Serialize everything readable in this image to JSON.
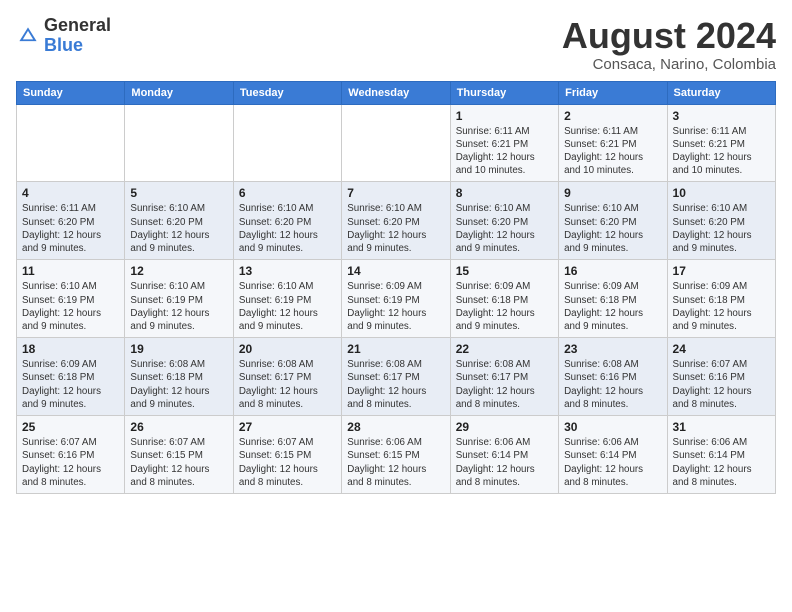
{
  "header": {
    "logo_line1": "General",
    "logo_line2": "Blue",
    "month_year": "August 2024",
    "location": "Consaca, Narino, Colombia"
  },
  "weekdays": [
    "Sunday",
    "Monday",
    "Tuesday",
    "Wednesday",
    "Thursday",
    "Friday",
    "Saturday"
  ],
  "weeks": [
    [
      {
        "day": "",
        "info": ""
      },
      {
        "day": "",
        "info": ""
      },
      {
        "day": "",
        "info": ""
      },
      {
        "day": "",
        "info": ""
      },
      {
        "day": "1",
        "info": "Sunrise: 6:11 AM\nSunset: 6:21 PM\nDaylight: 12 hours and 10 minutes."
      },
      {
        "day": "2",
        "info": "Sunrise: 6:11 AM\nSunset: 6:21 PM\nDaylight: 12 hours and 10 minutes."
      },
      {
        "day": "3",
        "info": "Sunrise: 6:11 AM\nSunset: 6:21 PM\nDaylight: 12 hours and 10 minutes."
      }
    ],
    [
      {
        "day": "4",
        "info": "Sunrise: 6:11 AM\nSunset: 6:20 PM\nDaylight: 12 hours and 9 minutes."
      },
      {
        "day": "5",
        "info": "Sunrise: 6:10 AM\nSunset: 6:20 PM\nDaylight: 12 hours and 9 minutes."
      },
      {
        "day": "6",
        "info": "Sunrise: 6:10 AM\nSunset: 6:20 PM\nDaylight: 12 hours and 9 minutes."
      },
      {
        "day": "7",
        "info": "Sunrise: 6:10 AM\nSunset: 6:20 PM\nDaylight: 12 hours and 9 minutes."
      },
      {
        "day": "8",
        "info": "Sunrise: 6:10 AM\nSunset: 6:20 PM\nDaylight: 12 hours and 9 minutes."
      },
      {
        "day": "9",
        "info": "Sunrise: 6:10 AM\nSunset: 6:20 PM\nDaylight: 12 hours and 9 minutes."
      },
      {
        "day": "10",
        "info": "Sunrise: 6:10 AM\nSunset: 6:20 PM\nDaylight: 12 hours and 9 minutes."
      }
    ],
    [
      {
        "day": "11",
        "info": "Sunrise: 6:10 AM\nSunset: 6:19 PM\nDaylight: 12 hours and 9 minutes."
      },
      {
        "day": "12",
        "info": "Sunrise: 6:10 AM\nSunset: 6:19 PM\nDaylight: 12 hours and 9 minutes."
      },
      {
        "day": "13",
        "info": "Sunrise: 6:10 AM\nSunset: 6:19 PM\nDaylight: 12 hours and 9 minutes."
      },
      {
        "day": "14",
        "info": "Sunrise: 6:09 AM\nSunset: 6:19 PM\nDaylight: 12 hours and 9 minutes."
      },
      {
        "day": "15",
        "info": "Sunrise: 6:09 AM\nSunset: 6:18 PM\nDaylight: 12 hours and 9 minutes."
      },
      {
        "day": "16",
        "info": "Sunrise: 6:09 AM\nSunset: 6:18 PM\nDaylight: 12 hours and 9 minutes."
      },
      {
        "day": "17",
        "info": "Sunrise: 6:09 AM\nSunset: 6:18 PM\nDaylight: 12 hours and 9 minutes."
      }
    ],
    [
      {
        "day": "18",
        "info": "Sunrise: 6:09 AM\nSunset: 6:18 PM\nDaylight: 12 hours and 9 minutes."
      },
      {
        "day": "19",
        "info": "Sunrise: 6:08 AM\nSunset: 6:18 PM\nDaylight: 12 hours and 9 minutes."
      },
      {
        "day": "20",
        "info": "Sunrise: 6:08 AM\nSunset: 6:17 PM\nDaylight: 12 hours and 8 minutes."
      },
      {
        "day": "21",
        "info": "Sunrise: 6:08 AM\nSunset: 6:17 PM\nDaylight: 12 hours and 8 minutes."
      },
      {
        "day": "22",
        "info": "Sunrise: 6:08 AM\nSunset: 6:17 PM\nDaylight: 12 hours and 8 minutes."
      },
      {
        "day": "23",
        "info": "Sunrise: 6:08 AM\nSunset: 6:16 PM\nDaylight: 12 hours and 8 minutes."
      },
      {
        "day": "24",
        "info": "Sunrise: 6:07 AM\nSunset: 6:16 PM\nDaylight: 12 hours and 8 minutes."
      }
    ],
    [
      {
        "day": "25",
        "info": "Sunrise: 6:07 AM\nSunset: 6:16 PM\nDaylight: 12 hours and 8 minutes."
      },
      {
        "day": "26",
        "info": "Sunrise: 6:07 AM\nSunset: 6:15 PM\nDaylight: 12 hours and 8 minutes."
      },
      {
        "day": "27",
        "info": "Sunrise: 6:07 AM\nSunset: 6:15 PM\nDaylight: 12 hours and 8 minutes."
      },
      {
        "day": "28",
        "info": "Sunrise: 6:06 AM\nSunset: 6:15 PM\nDaylight: 12 hours and 8 minutes."
      },
      {
        "day": "29",
        "info": "Sunrise: 6:06 AM\nSunset: 6:14 PM\nDaylight: 12 hours and 8 minutes."
      },
      {
        "day": "30",
        "info": "Sunrise: 6:06 AM\nSunset: 6:14 PM\nDaylight: 12 hours and 8 minutes."
      },
      {
        "day": "31",
        "info": "Sunrise: 6:06 AM\nSunset: 6:14 PM\nDaylight: 12 hours and 8 minutes."
      }
    ]
  ]
}
